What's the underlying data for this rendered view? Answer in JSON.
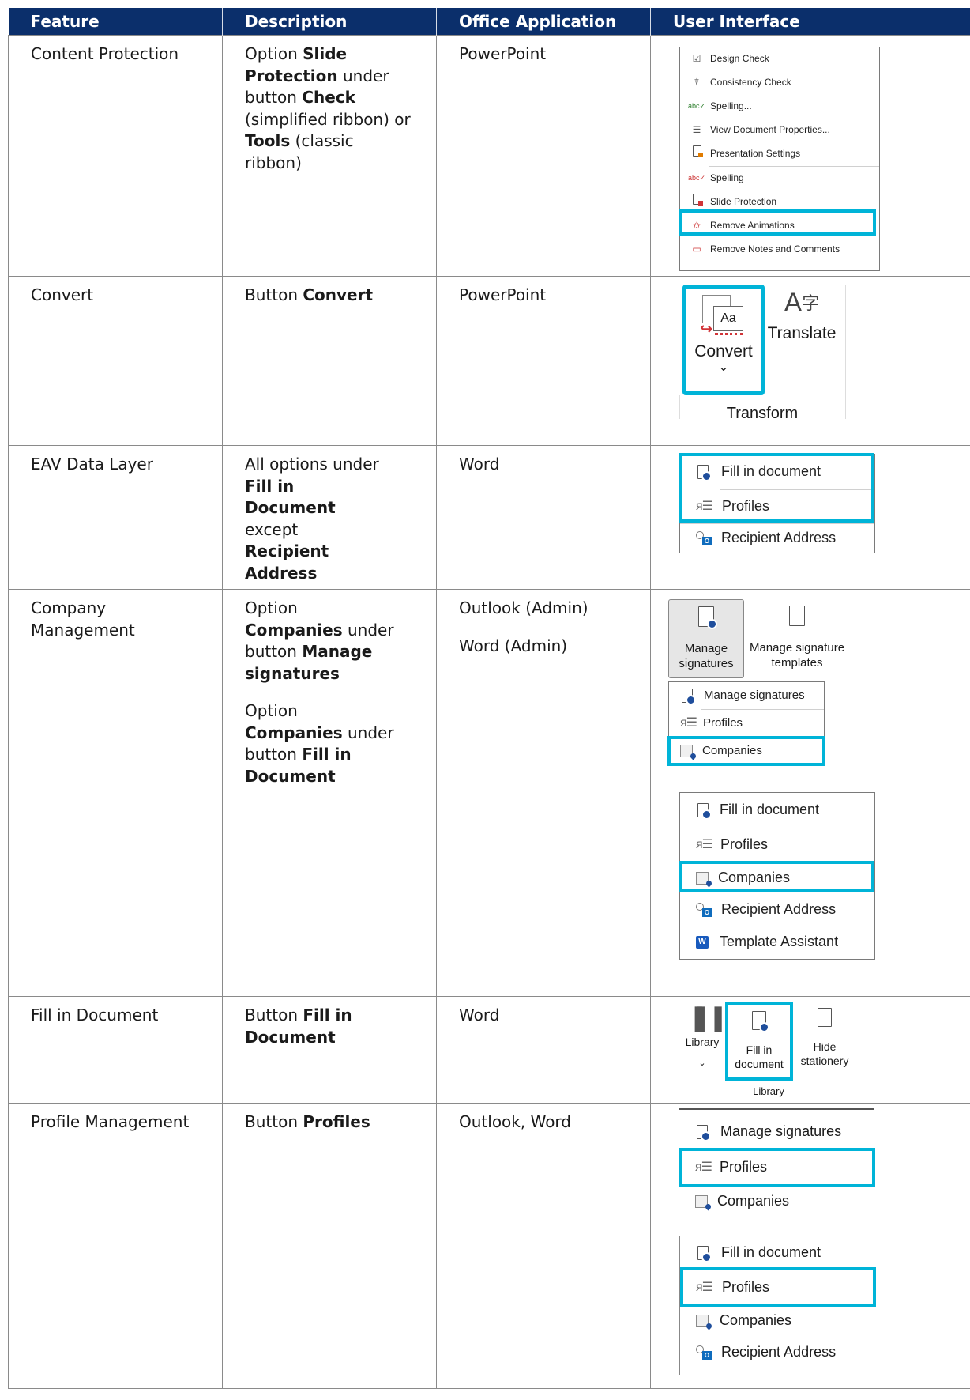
{
  "headers": [
    "Feature",
    "Description",
    "Office Application",
    "User Interface"
  ],
  "rows": [
    {
      "feature": "Content Protection",
      "desc": [
        "Option ",
        "Slide Protection",
        " under button ",
        "Check",
        " (simplified ribbon) or ",
        "Tools",
        " (classic ribbon)"
      ],
      "app": [
        "PowerPoint"
      ],
      "ui": {
        "items": [
          "Design Check",
          "Consistency Check",
          "Spelling...",
          "View Document Properties...",
          "Presentation Settings",
          "Spelling",
          "Slide Protection",
          "Remove Animations",
          "Remove Notes and Comments"
        ]
      }
    },
    {
      "feature": "Convert",
      "desc": [
        "Button ",
        "Convert"
      ],
      "app": [
        "PowerPoint"
      ],
      "ui": {
        "convert": "Convert",
        "translate": "Translate",
        "group": "Transform",
        "aa": "Aa",
        "chev": "⌄"
      }
    },
    {
      "feature": "EAV Data Layer",
      "desc": [
        "All options under ",
        "Fill in Document",
        " except ",
        "Recipient Address"
      ],
      "app": [
        "Word"
      ],
      "ui": {
        "items": [
          "Fill in document",
          "Profiles",
          "Recipient Address"
        ]
      }
    },
    {
      "feature": "Company Management",
      "desc1": [
        "Option ",
        "Companies",
        " under button ",
        "Manage signatures"
      ],
      "desc2": [
        "Option ",
        "Companies",
        " under button ",
        "Fill in Document"
      ],
      "app": [
        "Outlook (Admin)",
        "Word (Admin)"
      ],
      "ui": {
        "ribbon_manage": "Manage signatures",
        "ribbon_templates": "Manage signature templates",
        "menu_a": [
          "Manage signatures",
          "Profiles",
          "Companies"
        ],
        "menu_b": [
          "Fill in document",
          "Profiles",
          "Companies",
          "Recipient Address",
          "Template Assistant"
        ]
      }
    },
    {
      "feature": "Fill in Document",
      "desc": [
        "Button ",
        "Fill in Document"
      ],
      "app": [
        "Word"
      ],
      "ui": {
        "library": "Library",
        "fill": "Fill in document",
        "hide": "Hide stationery",
        "group": "Library"
      }
    },
    {
      "feature": "Profile Management",
      "desc": [
        "Button ",
        "Profiles"
      ],
      "app": [
        "Outlook, Word"
      ],
      "ui": {
        "menu_a": [
          "Manage signatures",
          "Profiles",
          "Companies"
        ],
        "menu_b": [
          "Fill in document",
          "Profiles",
          "Companies",
          "Recipient Address"
        ]
      }
    }
  ],
  "highlight_color": "#00b4d8",
  "header_color": "#0b2f6b"
}
